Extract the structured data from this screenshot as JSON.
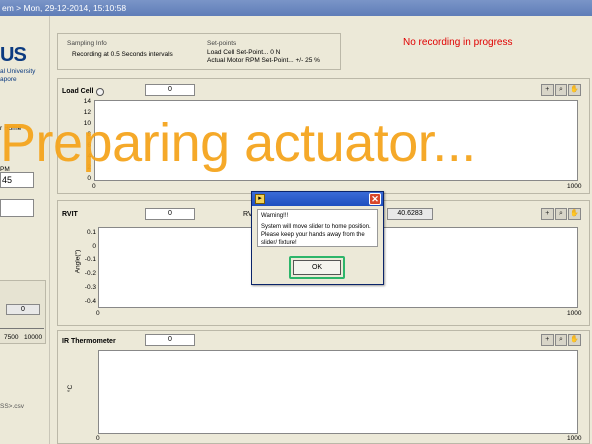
{
  "titlebar": {
    "text": "em > Mon, 29-12-2014, 15:10:58"
  },
  "sidebar": {
    "logo": "US",
    "logo_line1": "al University",
    "logo_line2": "apore",
    "home_label": "r Home",
    "pm_label": "PM",
    "value": "45",
    "slider_box": "0",
    "tick_7500": "7500",
    "tick_10000": "10000",
    "csv_label": "SS>.csv"
  },
  "info": {
    "sampling_label": "Sampling Info",
    "sampling_value": "Recording at 0.5 Seconds intervals",
    "setpoints_label": "Set-points",
    "setpoint_line1": "Load Cell Set-Point...  0 N",
    "setpoint_line2": "Actual Motor RPM Set-Point...  +/- 25 %",
    "status": "No recording in progress"
  },
  "load_cell": {
    "title": "Load Cell",
    "value": "0",
    "y_ticks": [
      "14",
      "12",
      "10",
      "8",
      "6",
      "4",
      "2",
      "0"
    ],
    "x_min": "0",
    "x_max": "1000"
  },
  "rvit": {
    "title": "RVIT",
    "value": "0",
    "second_label": "RV",
    "second_value": "40.6283",
    "ylabel": "Angle(°)",
    "y_ticks": [
      "0.1",
      "0",
      "-0.1",
      "-0.2",
      "-0.3",
      "-0.4"
    ],
    "x_min": "0",
    "x_max": "1000"
  },
  "ir": {
    "title": "IR Thermometer",
    "value": "0",
    "ylabel": "°C",
    "x_min": "0",
    "x_max": "1000"
  },
  "dialog": {
    "title_icon": "labview-icon",
    "close": "✕",
    "heading": "Warning!!!",
    "line1": "System will move slider to home position.",
    "line2": "Please keep your hands away from the",
    "line3": "slider/ fixture!",
    "ok": "OK"
  },
  "overlay": {
    "text": "Preparing actuator..."
  },
  "colors": {
    "overlay": "#F5A51E",
    "status": "#E00000",
    "highlight": "#2DB56A"
  }
}
